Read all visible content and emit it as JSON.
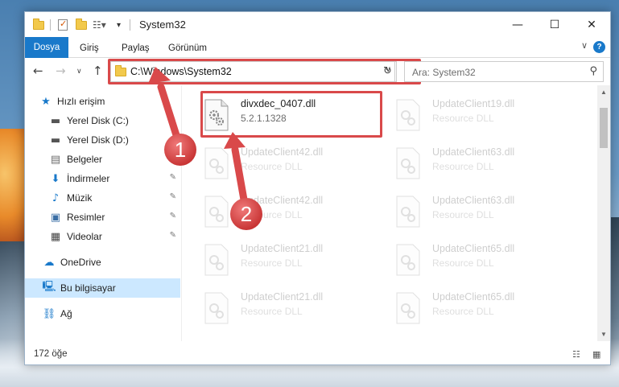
{
  "window": {
    "title": "System32",
    "minimize_glyph": "—",
    "maximize_glyph": "☐",
    "close_glyph": "✕"
  },
  "ribbon": {
    "tabs": [
      {
        "label": "Dosya",
        "active": true
      },
      {
        "label": "Giriş",
        "active": false
      },
      {
        "label": "Paylaş",
        "active": false
      },
      {
        "label": "Görünüm",
        "active": false
      }
    ],
    "help_glyph": "?",
    "expand_glyph": "∨"
  },
  "nav": {
    "back_glyph": "←",
    "forward_glyph": "→",
    "recent_glyph": "∨",
    "up_glyph": "↑",
    "address": "C:\\Windows\\System32",
    "address_dropdown_glyph": "∨",
    "refresh_glyph": "↻",
    "search_placeholder": "Ara: System32",
    "search_glyph": "⚲"
  },
  "sidebar": {
    "items": [
      {
        "label": "Hızlı erişim",
        "icon": "star-icon",
        "glyph": "★",
        "color": "#1979ca"
      },
      {
        "label": "Yerel Disk (C:)",
        "icon": "drive-icon",
        "glyph": "▬",
        "color": "#555555",
        "pinned": true
      },
      {
        "label": "Yerel Disk (D:)",
        "icon": "drive-icon",
        "glyph": "▬",
        "color": "#555555"
      },
      {
        "label": "Belgeler",
        "icon": "documents-icon",
        "glyph": "▤",
        "color": "#6d6d6d",
        "pinned": true
      },
      {
        "label": "İndirmeler",
        "icon": "download-icon",
        "glyph": "⬇",
        "color": "#1979ca",
        "pinned": true
      },
      {
        "label": "Müzik",
        "icon": "music-icon",
        "glyph": "♪",
        "color": "#1979ca",
        "pinned": true
      },
      {
        "label": "Resimler",
        "icon": "pictures-icon",
        "glyph": "▣",
        "color": "#3a6ea5",
        "pinned": true
      },
      {
        "label": "Videolar",
        "icon": "videos-icon",
        "glyph": "▦",
        "color": "#444444",
        "pinned": true
      },
      {
        "label": "OneDrive",
        "icon": "cloud-icon",
        "glyph": "☁",
        "color": "#1979ca"
      },
      {
        "label": "Bu bilgisayar",
        "icon": "computer-icon",
        "glyph": "🖳",
        "color": "#1979ca",
        "selected": true
      },
      {
        "label": "Ağ",
        "icon": "network-icon",
        "glyph": "⛓",
        "color": "#1979ca"
      }
    ],
    "pin_glyph": "📌"
  },
  "files": [
    {
      "name": "divxdec_0407.dll",
      "desc": "5.2.1.1328",
      "faded": false
    },
    {
      "name": "UpdateClient19.dll",
      "desc": "Resource DLL",
      "faded": true
    },
    {
      "name": "UpdateClient42.dll",
      "desc": "Resource DLL",
      "faded": true
    },
    {
      "name": "UpdateClient63.dll",
      "desc": "Resource DLL",
      "faded": true
    },
    {
      "name": "UpdateClient42.dll",
      "desc": "Resource DLL",
      "faded": true
    },
    {
      "name": "UpdateClient63.dll",
      "desc": "Resource DLL",
      "faded": true
    },
    {
      "name": "UpdateClient21.dll",
      "desc": "Resource DLL",
      "faded": true
    },
    {
      "name": "UpdateClient65.dll",
      "desc": "Resource DLL",
      "faded": true
    },
    {
      "name": "UpdateClient21.dll",
      "desc": "Resource DLL",
      "faded": true
    },
    {
      "name": "UpdateClient65.dll",
      "desc": "Resource DLL",
      "faded": true
    }
  ],
  "status": {
    "item_count": "172 öğe",
    "details_view_glyph": "☷",
    "tiles_view_glyph": "▦"
  },
  "annotations": [
    {
      "number": "1"
    },
    {
      "number": "2"
    }
  ],
  "colors": {
    "accent": "#1979ca",
    "highlight": "#d9494a",
    "selected_bg": "#cce8ff"
  }
}
